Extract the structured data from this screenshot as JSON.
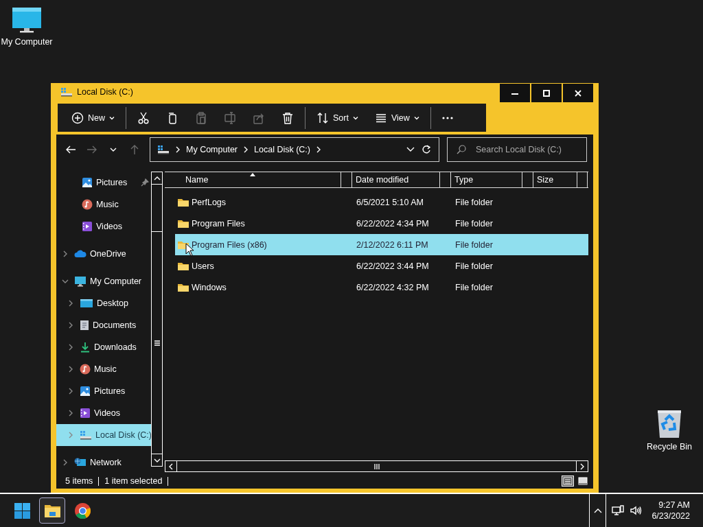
{
  "desktop_icons": [
    {
      "kind": "computer",
      "label": "My Computer"
    },
    {
      "kind": "recycle",
      "label": "Recycle Bin"
    }
  ],
  "window": {
    "title": "Local Disk (C:)"
  },
  "command_bar": [
    {
      "kind": "new",
      "label": "New",
      "disabled": false
    },
    {
      "kind": "separator"
    },
    {
      "kind": "cut",
      "disabled": false
    },
    {
      "kind": "copy",
      "disabled": false
    },
    {
      "kind": "paste",
      "disabled": true
    },
    {
      "kind": "rename",
      "disabled": true
    },
    {
      "kind": "share",
      "disabled": true
    },
    {
      "kind": "delete",
      "disabled": false
    },
    {
      "kind": "separator"
    },
    {
      "kind": "sort",
      "label": "Sort",
      "disabled": false
    },
    {
      "kind": "view",
      "label": "View",
      "disabled": false
    },
    {
      "kind": "separator"
    },
    {
      "kind": "more",
      "disabled": false
    }
  ],
  "navigation": [
    {
      "kind": "back",
      "disabled": false
    },
    {
      "kind": "forward",
      "disabled": true
    },
    {
      "kind": "recent",
      "disabled": false
    },
    {
      "kind": "up",
      "disabled": true
    }
  ],
  "address_bar": {
    "crumbs": [
      "My Computer",
      "Local Disk (C:)"
    ]
  },
  "search": {
    "placeholder": "Search Local Disk (C:)"
  },
  "sidebar": {
    "quick_items": [
      {
        "kind": "pictures",
        "label": "Pictures",
        "pinned": true,
        "selected": false
      },
      {
        "kind": "music",
        "label": "Music",
        "pinned": false,
        "selected": false
      },
      {
        "kind": "videos",
        "label": "Videos",
        "pinned": false,
        "selected": false
      }
    ],
    "tree": [
      {
        "kind": "cloud",
        "label": "OneDrive",
        "expanded": false,
        "selected": false
      },
      {
        "kind": "computer",
        "label": "My Computer",
        "expanded": true,
        "selected": false,
        "children": [
          {
            "kind": "desktop",
            "label": "Desktop",
            "expanded": false,
            "selected": false
          },
          {
            "kind": "documents",
            "label": "Documents",
            "expanded": false,
            "selected": false
          },
          {
            "kind": "downloads",
            "label": "Downloads",
            "expanded": false,
            "selected": false
          },
          {
            "kind": "music",
            "label": "Music",
            "expanded": false,
            "selected": false
          },
          {
            "kind": "pictures",
            "label": "Pictures",
            "expanded": false,
            "selected": false
          },
          {
            "kind": "videos",
            "label": "Videos",
            "expanded": false,
            "selected": false
          },
          {
            "kind": "disk",
            "label": "Local Disk (C:)",
            "expanded": false,
            "selected": true
          }
        ]
      },
      {
        "kind": "network",
        "label": "Network",
        "expanded": false,
        "selected": false
      }
    ]
  },
  "file_list": {
    "columns": [
      {
        "label": "Name",
        "sorted": true
      },
      {
        "label": "Date modified",
        "sorted": false
      },
      {
        "label": "Type",
        "sorted": false
      },
      {
        "label": "Size",
        "sorted": false
      }
    ],
    "rows": [
      {
        "name": "PerfLogs",
        "date": "6/5/2021 5:10 AM",
        "type": "File folder",
        "selected": false
      },
      {
        "name": "Program Files",
        "date": "6/22/2022 4:34 PM",
        "type": "File folder",
        "selected": false
      },
      {
        "name": "Program Files (x86)",
        "date": "2/12/2022 6:11 PM",
        "type": "File folder",
        "selected": true
      },
      {
        "name": "Users",
        "date": "6/22/2022 3:44 PM",
        "type": "File folder",
        "selected": false
      },
      {
        "name": "Windows",
        "date": "6/22/2022 4:32 PM",
        "type": "File folder",
        "selected": false
      }
    ]
  },
  "status_bar": {
    "texts": [
      "5 items",
      "1 item selected"
    ],
    "views": [
      {
        "kind": "details",
        "selected": true
      },
      {
        "kind": "tiles",
        "selected": false
      }
    ]
  },
  "taskbar": {
    "apps": [
      {
        "kind": "start",
        "active": false
      },
      {
        "kind": "explorer",
        "active": true
      },
      {
        "kind": "chrome",
        "active": false
      }
    ],
    "tray": {
      "time": "9:27 AM",
      "date": "6/23/2022"
    }
  }
}
